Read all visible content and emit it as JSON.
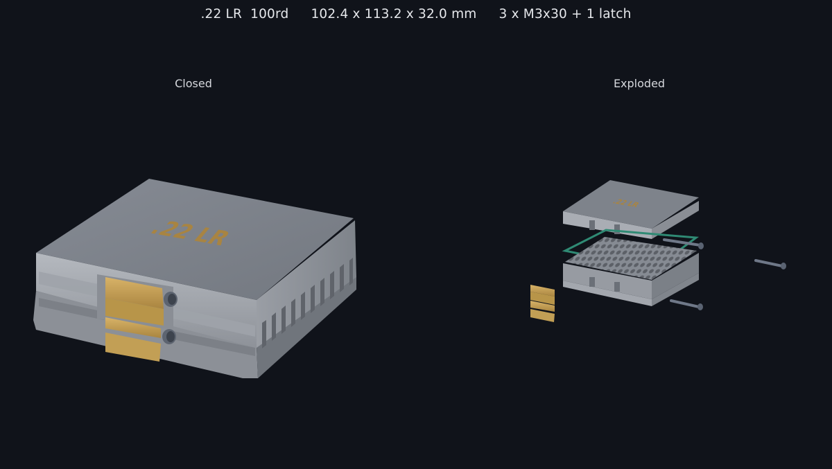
{
  "header": {
    "caliber": ".22 LR",
    "round_count": "100rd",
    "dimensions": "102.4 x 113.2 x 32.0 mm",
    "hardware": "3 x M3x30 + 1 latch"
  },
  "views": {
    "closed": {
      "label": "Closed",
      "lid_text": ".22 LR"
    },
    "exploded": {
      "label": "Exploded",
      "lid_text": ".22 LR"
    }
  },
  "colors": {
    "background": "#10131a",
    "case_top": "#7d828b",
    "case_side": "#a6aab1",
    "case_dark": "#5d6168",
    "latch": "#c9a35a",
    "gasket": "#2f8a74",
    "screw": "#6f7888",
    "engraving": "#a88442"
  }
}
